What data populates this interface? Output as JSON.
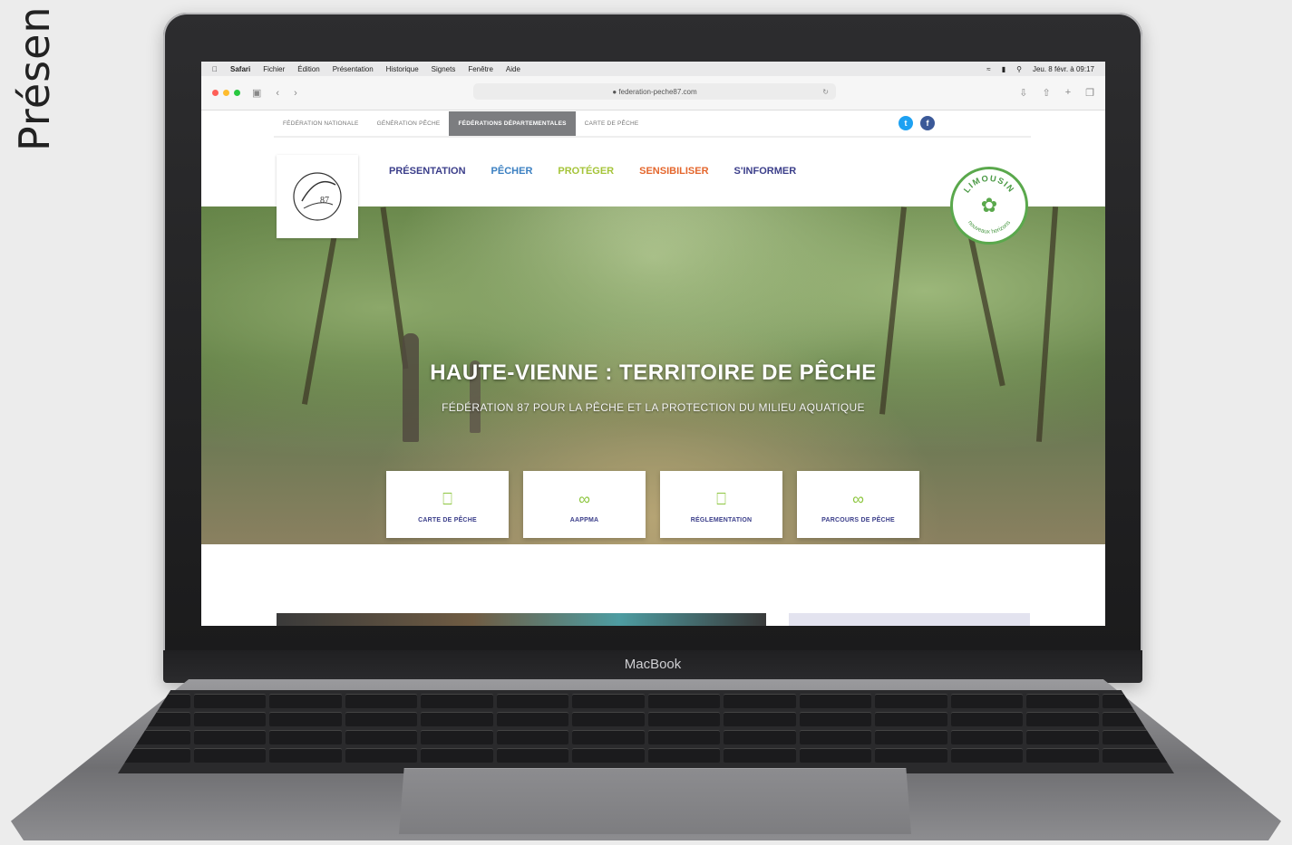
{
  "side_text": "Présen",
  "device": {
    "label": "MacBook"
  },
  "mac_menu": {
    "app": "Safari",
    "items": [
      "Fichier",
      "Édition",
      "Présentation",
      "Historique",
      "Signets",
      "Fenêtre",
      "Aide"
    ],
    "clock": "Jeu. 8 févr. à 09:17"
  },
  "browser": {
    "url": "federation-peche87.com"
  },
  "site": {
    "top_nav": [
      "FÉDÉRATION NATIONALE",
      "GÉNÉRATION PÊCHE",
      "FÉDÉRATIONS DÉPARTEMENTALES",
      "CARTE DE PÊCHE"
    ],
    "top_nav_active": "FÉDÉRATIONS DÉPARTEMENTALES",
    "main_nav": [
      {
        "label": "PRÉSENTATION",
        "color": "#3b3e8a"
      },
      {
        "label": "PÊCHER",
        "color": "#3a7fc1"
      },
      {
        "label": "PROTÉGER",
        "color": "#a5c439"
      },
      {
        "label": "SENSIBILISER",
        "color": "#e4662c"
      },
      {
        "label": "S'INFORMER",
        "color": "#3b3e8a"
      }
    ],
    "logo_text": "87",
    "hero": {
      "title": "HAUTE-VIENNE : TERRITOIRE DE PÊCHE",
      "subtitle": "FÉDÉRATION 87 POUR LA PÊCHE ET LA PROTECTION DU MILIEU AQUATIQUE"
    },
    "cards": [
      {
        "label": "CARTE DE PÊCHE",
        "icon": "card-icon"
      },
      {
        "label": "AAPPMA",
        "icon": "fish-icon"
      },
      {
        "label": "RÉGLEMENTATION",
        "icon": "card-icon"
      },
      {
        "label": "PARCOURS DE PÊCHE",
        "icon": "fish-icon"
      }
    ],
    "badge": {
      "top": "LIMOUSIN",
      "bottom": "nouveaux horizons"
    }
  },
  "colors": {
    "accent_green": "#8dc63f",
    "navy": "#3b3e8a",
    "twitter": "#1da1f2",
    "facebook": "#3b5998"
  }
}
